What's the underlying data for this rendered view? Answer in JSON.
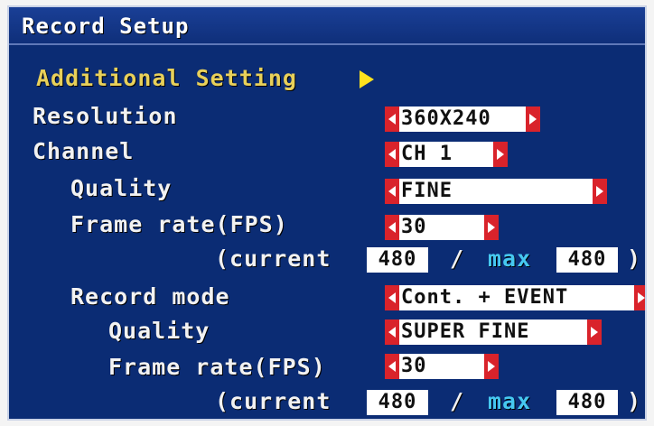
{
  "title": "Record Setup",
  "additional_setting": "Additional Setting",
  "resolution": {
    "label": "Resolution",
    "value": "360X240"
  },
  "channel": {
    "label": "Channel",
    "value": "CH 1"
  },
  "quality": {
    "label": "Quality",
    "value": "FINE"
  },
  "frame_rate": {
    "label": "Frame rate(FPS)",
    "value": "30"
  },
  "current_line_1": {
    "open": "(current",
    "current": "480",
    "slash": "/",
    "max_label": "max",
    "max": "480",
    "close": ")"
  },
  "record_mode": {
    "label": "Record mode",
    "value": "Cont. + EVENT"
  },
  "event_quality": {
    "label": "Quality",
    "value": "SUPER FINE"
  },
  "event_frame_rate": {
    "label": "Frame rate(FPS)",
    "value": "30"
  },
  "current_line_2": {
    "open": "(current",
    "current": "480",
    "slash": "/",
    "max_label": "max",
    "max": "480",
    "close": ")"
  },
  "colors": {
    "background": "#0b2c74",
    "selector_arrow": "#d9232b",
    "highlight_text": "#e8d05a",
    "arrow": "#ffe21e",
    "max_text": "#46c8f0"
  },
  "icons": {
    "submenu": "right-triangle-icon",
    "selector_left": "left-arrow-icon",
    "selector_right": "right-arrow-icon"
  }
}
